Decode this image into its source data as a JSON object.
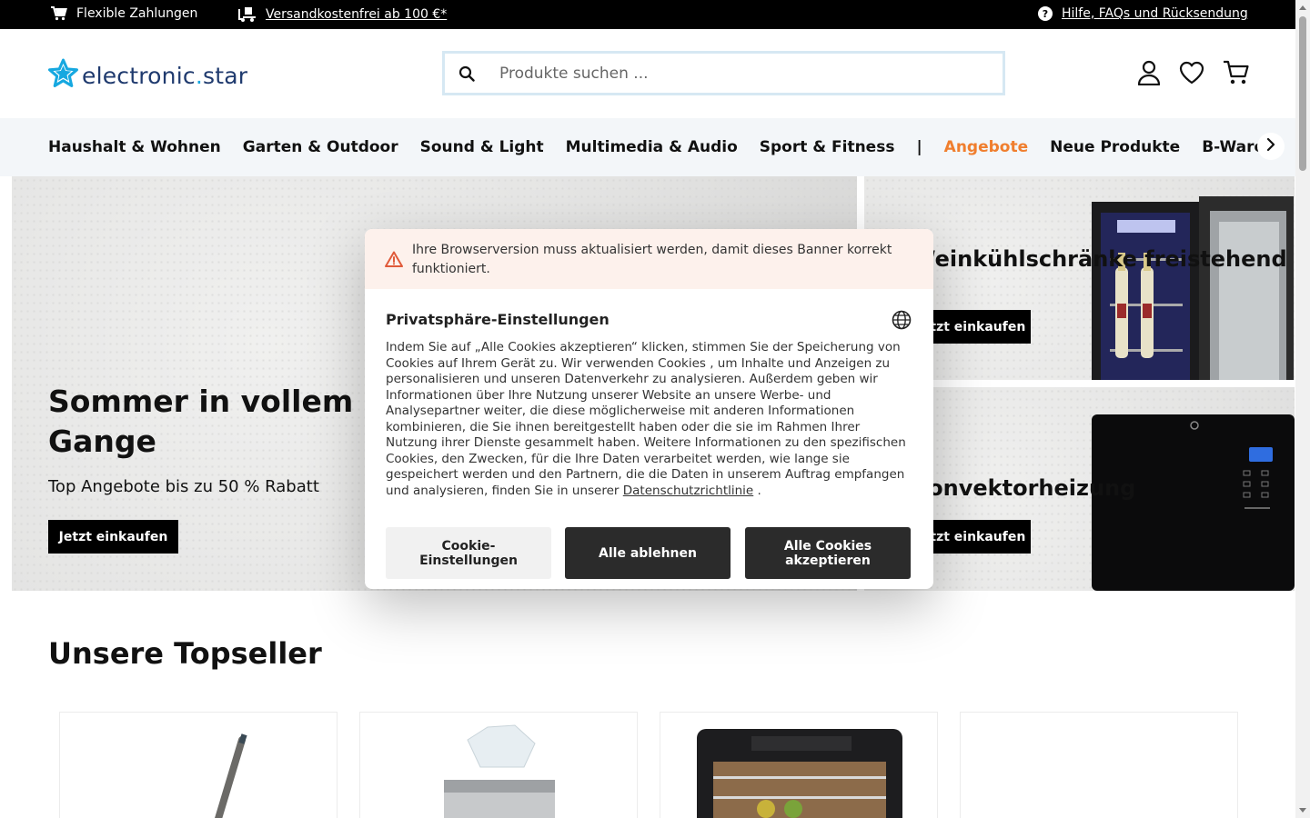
{
  "topbar": {
    "payments": "Flexible Zahlungen",
    "shipping": "Versandkostenfrei ab 100 €*",
    "help": "Hilfe, FAQs und Rücksendung"
  },
  "header": {
    "logo_left": "electronic",
    "logo_dot": ".",
    "logo_right": "star",
    "search_placeholder": "Produkte suchen ...",
    "icons": [
      "account-icon",
      "heart-icon",
      "cart-icon"
    ]
  },
  "nav": {
    "items": [
      "Haushalt & Wohnen",
      "Garten & Outdoor",
      "Sound & Light",
      "Multimedia & Audio",
      "Sport & Fitness"
    ],
    "separator": "|",
    "offers": "Angebote",
    "new": "Neue Produkte",
    "bware": "B-Ware"
  },
  "hero": {
    "title": "Sommer in vollem Gange",
    "subtitle": "Top Angebote bis zu 50 % Rabatt",
    "cta": "Jetzt einkaufen"
  },
  "side_cards": [
    {
      "title": "Weinkühlschränke freistehend",
      "cta": "Jetzt einkaufen"
    },
    {
      "title": "Konvektorheizung",
      "cta": "Jetzt einkaufen"
    }
  ],
  "topseller": {
    "title": "Unsere Topseller"
  },
  "cookie_modal": {
    "warning": "Ihre Browserversion muss aktualisiert werden, damit dieses Banner korrekt funktioniert.",
    "title": "Privatsphäre-Einstellungen",
    "body": "Indem Sie auf „Alle Cookies akzeptieren“ klicken, stimmen Sie der Speicherung von Cookies auf Ihrem Gerät zu. Wir verwenden Cookies , um Inhalte und Anzeigen zu personalisieren und unseren Datenverkehr zu analysieren. Außerdem geben wir Informationen über Ihre Nutzung unserer Website an unsere Werbe- und Analysepartner weiter, die diese möglicherweise mit anderen Informationen kombinieren, die Sie ihnen bereitgestellt haben oder die sie im Rahmen Ihrer Nutzung ihrer Dienste gesammelt haben. Weitere Informationen zu den spezifischen Cookies, den Zwecken, für die Ihre Daten verarbeitet werden, wie lange sie gespeichert werden und den Partnern, die die Daten in unserem Auftrag empfangen und analysieren, finden Sie in unserer",
    "link": "Datenschutzrichtlinie",
    "tail": " .",
    "btn_settings": "Cookie-Einstellungen",
    "btn_reject": "Alle ablehnen",
    "btn_accept": "Alle Cookies akzeptieren"
  },
  "colors": {
    "accent": "#f07e2e",
    "brand": "#1f3a6e",
    "brand_star": "#16a8e0",
    "topbar": "#000000",
    "warning_bg": "#fdf1ec",
    "warning_icon": "#e05a3a"
  }
}
